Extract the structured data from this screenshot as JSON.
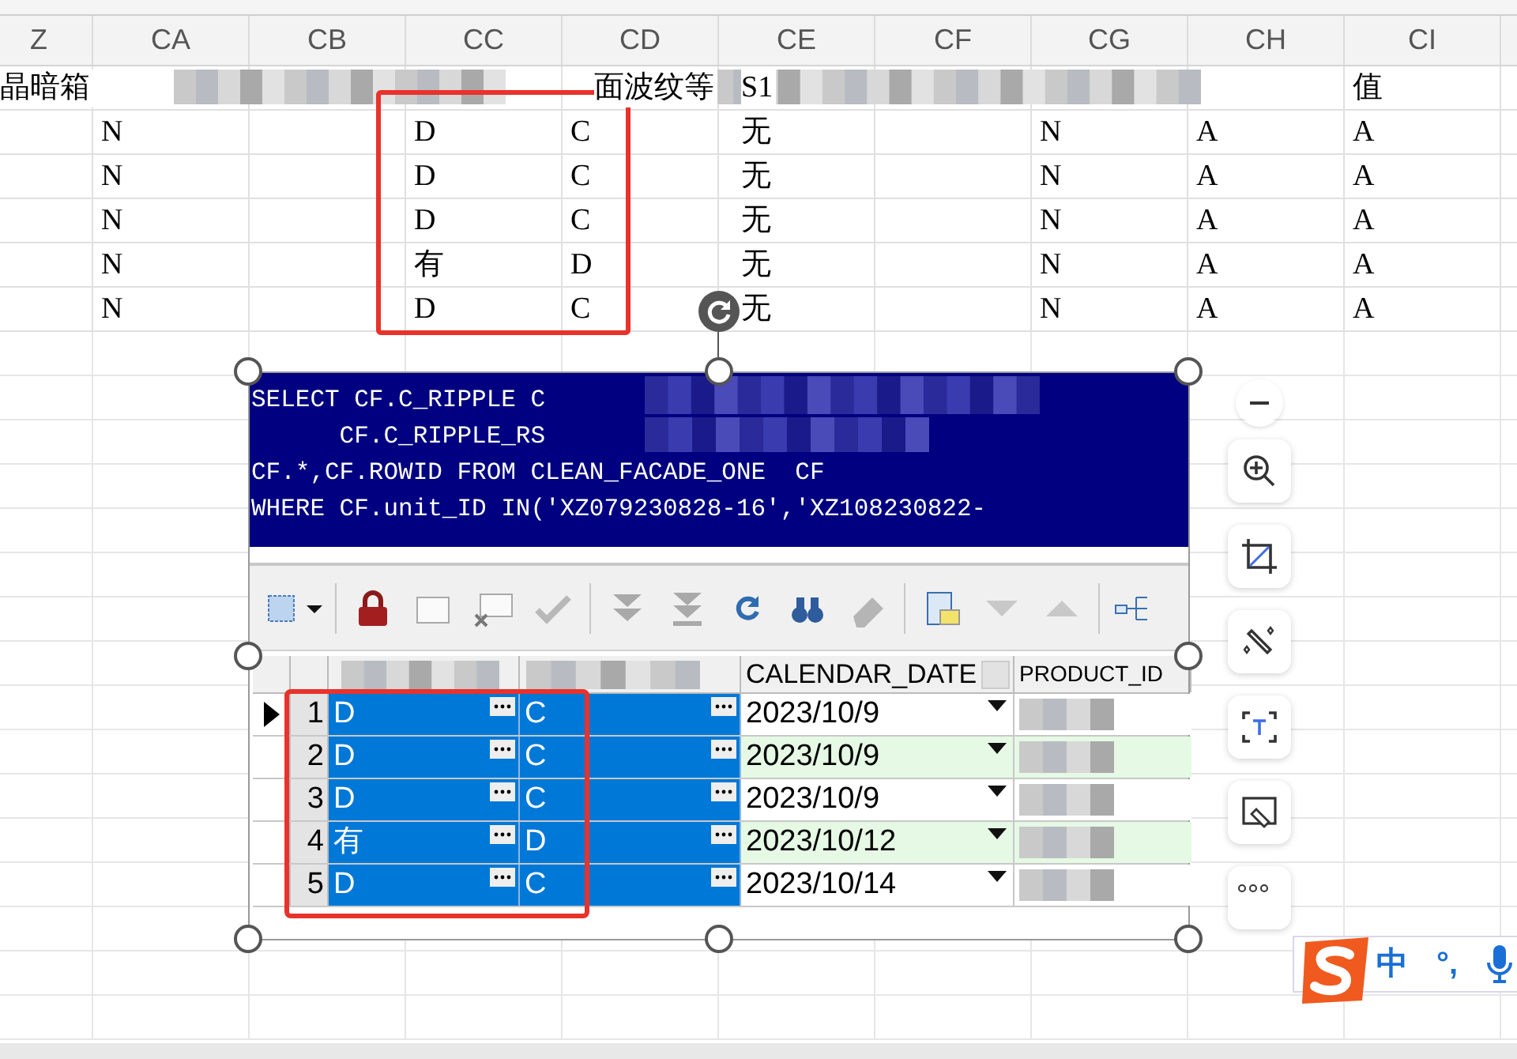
{
  "spreadsheet": {
    "columns": [
      "Z",
      "CA",
      "CB",
      "CC",
      "CD",
      "CE",
      "CF",
      "CG",
      "CH",
      "CI"
    ],
    "rows": [
      [
        "晶暗箱",
        "",
        "",
        "",
        "面波纹等",
        "S1",
        "",
        "",
        "",
        "值"
      ],
      [
        "",
        "N",
        "",
        "D",
        "C",
        "无",
        "",
        "N",
        "A",
        "A"
      ],
      [
        "",
        "N",
        "",
        "D",
        "C",
        "无",
        "",
        "N",
        "A",
        "A"
      ],
      [
        "",
        "N",
        "",
        "D",
        "C",
        "无",
        "",
        "N",
        "A",
        "A"
      ],
      [
        "",
        "N",
        "",
        "有",
        "D",
        "无",
        "",
        "N",
        "A",
        "A"
      ],
      [
        "",
        "N",
        "",
        "D",
        "C",
        "无",
        "",
        "N",
        "A",
        "A"
      ]
    ]
  },
  "pasted_image": {
    "sql_lines": [
      "SELECT CF.C_RIPPLE C",
      "      CF.C_RIPPLE_RS",
      "CF.*,CF.ROWID FROM CLEAN_FACADE_ONE  CF",
      "WHERE CF.unit_ID IN('XZ079230828-16','XZ108230822-"
    ],
    "grid": {
      "columns": [
        "CALENDAR_DATE",
        "PRODUCT_ID"
      ],
      "rows": [
        {
          "num": "1",
          "current": true,
          "col_1": "D",
          "col_2": "C",
          "calendar_date": "2023/10/9"
        },
        {
          "num": "2",
          "current": false,
          "col_1": "D",
          "col_2": "C",
          "calendar_date": "2023/10/9"
        },
        {
          "num": "3",
          "current": false,
          "col_1": "D",
          "col_2": "C",
          "calendar_date": "2023/10/9"
        },
        {
          "num": "4",
          "current": false,
          "col_1": "有",
          "col_2": "D",
          "calendar_date": "2023/10/12"
        },
        {
          "num": "5",
          "current": false,
          "col_1": "D",
          "col_2": "C",
          "calendar_date": "2023/10/14"
        }
      ]
    }
  },
  "ime_bar": {
    "mode": "中",
    "punctuation": "°,"
  }
}
